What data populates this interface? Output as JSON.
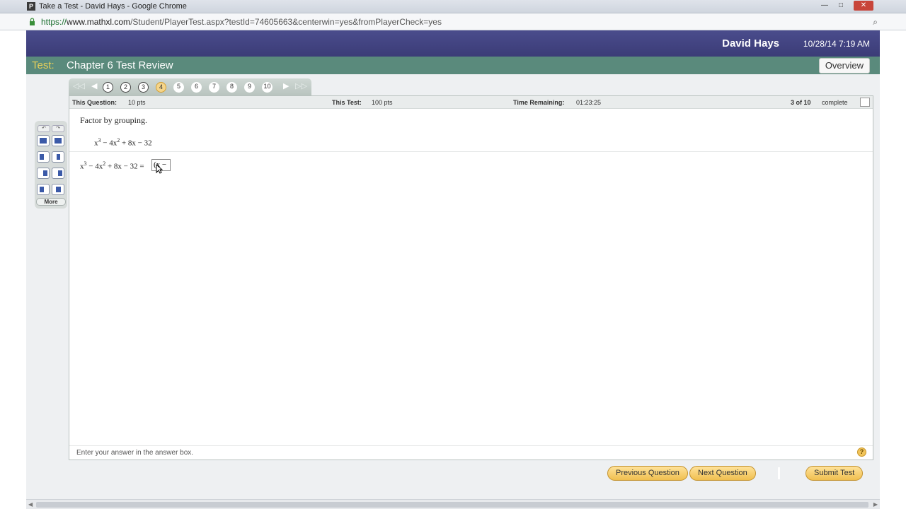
{
  "window": {
    "title": "Take a Test - David Hays - Google Chrome",
    "app_icon_letter": "P",
    "minimize": "—",
    "maximize": "□",
    "close": "✕"
  },
  "address": {
    "protocol": "https://",
    "host": "www.mathxl.com",
    "path": "/Student/PlayerTest.aspx?testId=74605663&centerwin=yes&fromPlayerCheck=yes",
    "zoom_icon": "⌕"
  },
  "header": {
    "user_name": "David Hays",
    "datetime": "10/28/14 7:19 AM"
  },
  "test": {
    "label": "Test:",
    "name": "Chapter 6 Test Review",
    "overview_label": "Overview"
  },
  "question_nav": {
    "first": "◁◁",
    "prev": "◀",
    "next": "▶",
    "last": "▷▷",
    "questions": [
      "1",
      "2",
      "3",
      "4",
      "5",
      "6",
      "7",
      "8",
      "9",
      "10"
    ],
    "current": "4"
  },
  "info": {
    "this_question_label": "This Question:",
    "this_question_value": "10 pts",
    "this_test_label": "This Test:",
    "this_test_value": "100 pts",
    "time_label": "Time Remaining:",
    "time_value": "01:23:25",
    "progress_value": "3 of 10",
    "progress_label": "complete"
  },
  "question": {
    "instruction": "Factor by grouping.",
    "poly_x": "x",
    "poly_exp1": "3",
    "poly_mid": " − 4x",
    "poly_exp2": "2",
    "poly_tail": " + 8x − 32",
    "answer_eq": " + 8x − 32 = ",
    "answer_input": "(x −"
  },
  "palette": {
    "undo": "↶",
    "redo": "↷",
    "more_label": "More"
  },
  "footer": {
    "hint": "Enter your answer in the answer box.",
    "help_icon": "?"
  },
  "buttons": {
    "previous": "Previous Question",
    "next": "Next Question",
    "submit": "Submit Test"
  },
  "colors": {
    "header_bg": "#3b3c77",
    "testbar_bg": "#5a8a7c",
    "test_label": "#e6cf5a",
    "button_bg": "#f0bf4f"
  }
}
